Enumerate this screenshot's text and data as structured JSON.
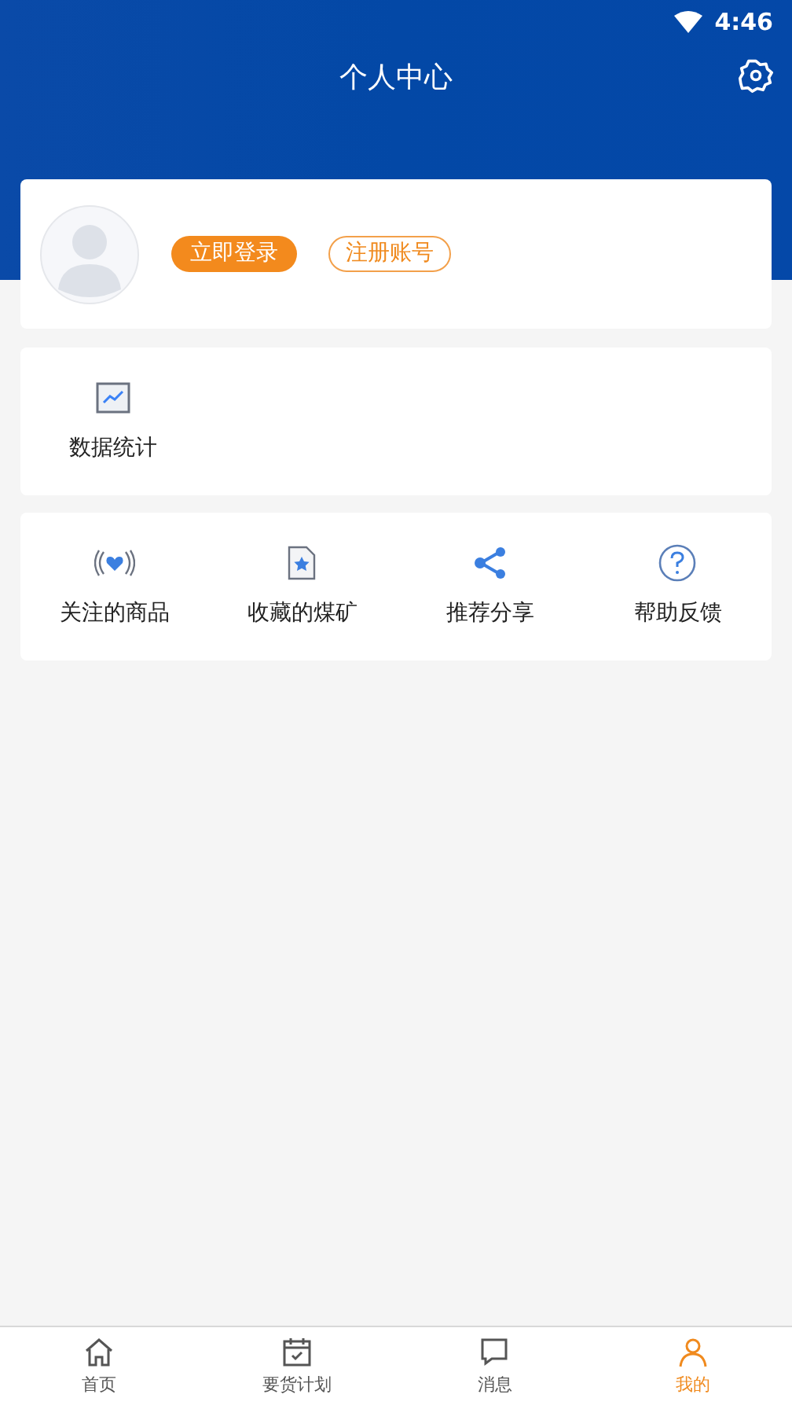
{
  "status_bar": {
    "time": "4:46"
  },
  "header": {
    "title": "个人中心"
  },
  "profile": {
    "login_button": "立即登录",
    "register_button": "注册账号"
  },
  "stats_card": {
    "items": [
      {
        "label": "数据统计",
        "kind": "chart"
      }
    ]
  },
  "menu_card": {
    "items": [
      {
        "label": "关注的商品",
        "kind": "follow"
      },
      {
        "label": "收藏的煤矿",
        "kind": "favorite"
      },
      {
        "label": "推荐分享",
        "kind": "share"
      },
      {
        "label": "帮助反馈",
        "kind": "help"
      }
    ]
  },
  "tab_bar": [
    {
      "label": "首页",
      "kind": "home",
      "selected": false
    },
    {
      "label": "要货计划",
      "kind": "calendar",
      "selected": false
    },
    {
      "label": "消息",
      "kind": "message",
      "selected": false
    },
    {
      "label": "我的",
      "kind": "person",
      "selected": true
    }
  ]
}
